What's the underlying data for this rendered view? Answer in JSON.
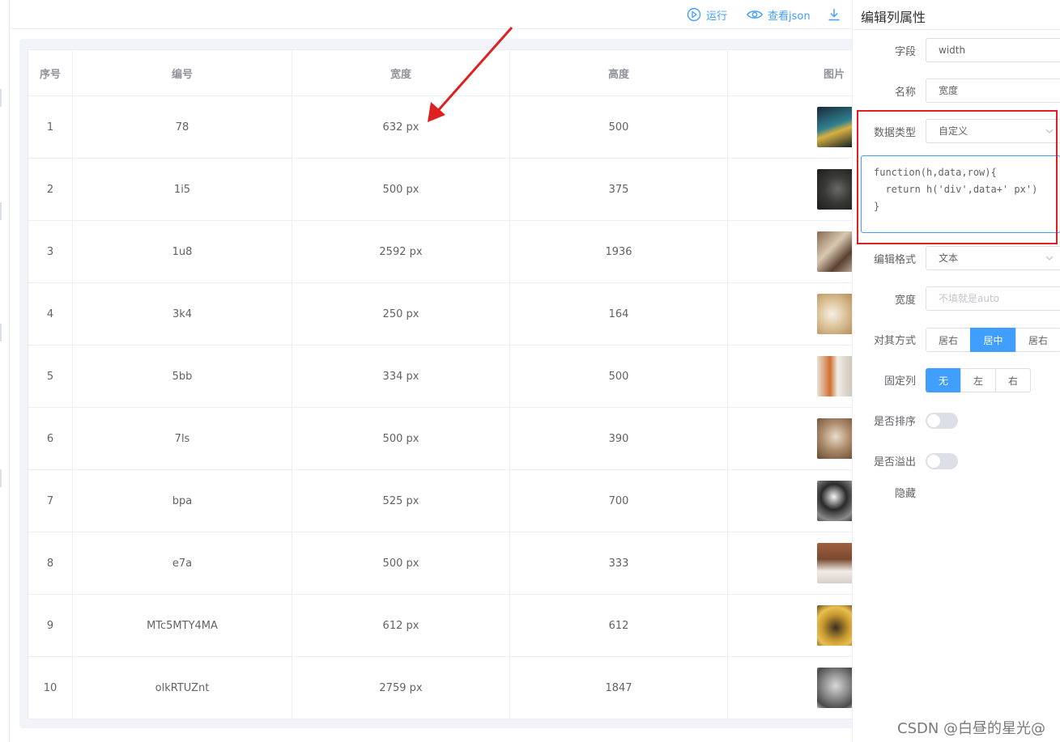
{
  "toolbar": {
    "run_label": "运行",
    "view_json_label": "查看json"
  },
  "table": {
    "headers": [
      "序号",
      "编号",
      "宽度",
      "高度",
      "图片"
    ],
    "rows": [
      {
        "index": "1",
        "code": "78",
        "width": "632 px",
        "height": "500"
      },
      {
        "index": "2",
        "code": "1i5",
        "width": "500 px",
        "height": "375"
      },
      {
        "index": "3",
        "code": "1u8",
        "width": "2592 px",
        "height": "1936"
      },
      {
        "index": "4",
        "code": "3k4",
        "width": "250 px",
        "height": "164"
      },
      {
        "index": "5",
        "code": "5bb",
        "width": "334 px",
        "height": "500"
      },
      {
        "index": "6",
        "code": "7ls",
        "width": "500 px",
        "height": "390"
      },
      {
        "index": "7",
        "code": "bpa",
        "width": "525 px",
        "height": "700"
      },
      {
        "index": "8",
        "code": "e7a",
        "width": "500 px",
        "height": "333"
      },
      {
        "index": "9",
        "code": "MTc5MTY4MA",
        "width": "612 px",
        "height": "612"
      },
      {
        "index": "10",
        "code": "olkRTUZnt",
        "width": "2759 px",
        "height": "1847"
      }
    ]
  },
  "panel": {
    "title": "编辑列属性",
    "field_label": "字段",
    "field_value": "width",
    "name_label": "名称",
    "name_value": "宽度",
    "datatype_label": "数据类型",
    "datatype_value": "自定义",
    "code": "function(h,data,row){\n  return h('div',data+' px')\n}",
    "edit_format_label": "编辑格式",
    "edit_format_value": "文本",
    "width_label": "宽度",
    "width_placeholder": "不填就是auto",
    "align_label": "对其方式",
    "align_options": [
      "居右",
      "居中",
      "居右"
    ],
    "align_selected": "居中",
    "fixed_label": "固定列",
    "fixed_options": [
      "无",
      "左",
      "右"
    ],
    "fixed_selected": "无",
    "sortable_label": "是否排序",
    "sortable_on": false,
    "overflow_label": "是否溢出",
    "overflow_label_2": "隐藏",
    "overflow_on": false
  },
  "watermark": "CSDN @白昼的星光@",
  "colors": {
    "accent": "#409eff",
    "highlight_box": "#e02020",
    "arrow": "#e02020"
  }
}
